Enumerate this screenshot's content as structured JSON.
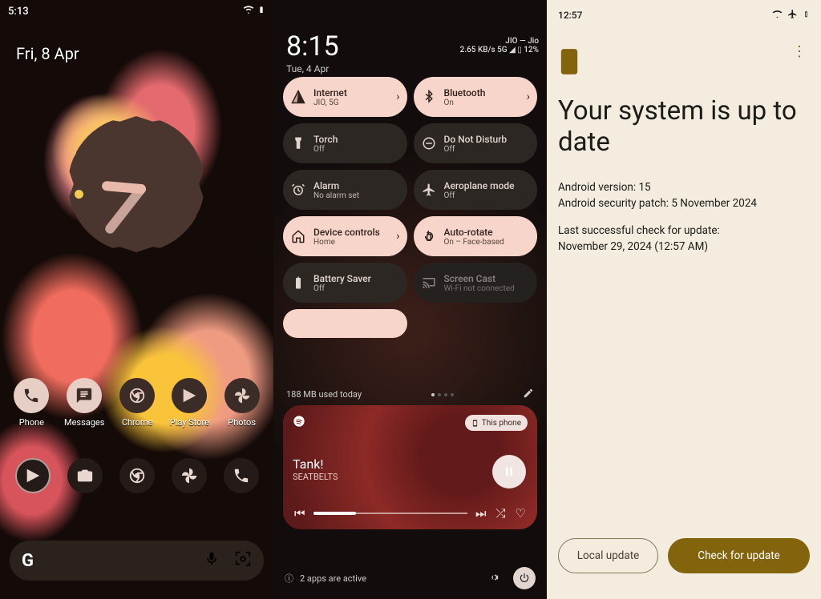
{
  "panel1": {
    "time": "5:13",
    "date": "Fri, 8 Apr",
    "apps": [
      {
        "label": "Phone",
        "icon": "phone"
      },
      {
        "label": "Messages",
        "icon": "message"
      },
      {
        "label": "Chrome",
        "icon": "chrome"
      },
      {
        "label": "Play Store",
        "icon": "play"
      },
      {
        "label": "Photos",
        "icon": "photos"
      }
    ],
    "row2": [
      "play",
      "camera",
      "chrome",
      "photos",
      "phone"
    ]
  },
  "panel2": {
    "time": "8:15",
    "date": "Tue, 4 Apr",
    "carrier": "JIO — Jio",
    "netline": "2.65 KB/s  5G ◢ ▯ 12%",
    "tiles": [
      {
        "title": "Internet",
        "sub": "JIO, 5G",
        "on": true,
        "icon": "signal",
        "chev": true
      },
      {
        "title": "Bluetooth",
        "sub": "On",
        "on": true,
        "icon": "bt",
        "chev": true
      },
      {
        "title": "Torch",
        "sub": "Off",
        "on": false,
        "icon": "torch"
      },
      {
        "title": "Do Not Disturb",
        "sub": "Off",
        "on": false,
        "icon": "dnd"
      },
      {
        "title": "Alarm",
        "sub": "No alarm set",
        "on": false,
        "icon": "alarm"
      },
      {
        "title": "Aeroplane mode",
        "sub": "Off",
        "on": false,
        "icon": "plane"
      },
      {
        "title": "Device controls",
        "sub": "Home",
        "on": true,
        "icon": "home",
        "chev": true
      },
      {
        "title": "Auto-rotate",
        "sub": "On – Face-based",
        "on": true,
        "icon": "rotate"
      },
      {
        "title": "Battery Saver",
        "sub": "Off",
        "on": false,
        "icon": "battsav"
      },
      {
        "title": "Screen Cast",
        "sub": "Wi-Fi not connected",
        "on": false,
        "icon": "cast",
        "dim": true
      }
    ],
    "data_used": "188 MB used today",
    "media": {
      "device": "This phone",
      "title": "Tank!",
      "artist": "SEATBELTS"
    },
    "footer": "2 apps are active"
  },
  "panel3": {
    "time": "12:57",
    "heading": "Your system is up to date",
    "version_label": "Android version: 15",
    "patch_label": "Android security patch: 5 November 2024",
    "last_check_label": "Last successful check for update:",
    "last_check_value": "November 29, 2024 (12:57 AM)",
    "btn_local": "Local update",
    "btn_check": "Check for update"
  }
}
